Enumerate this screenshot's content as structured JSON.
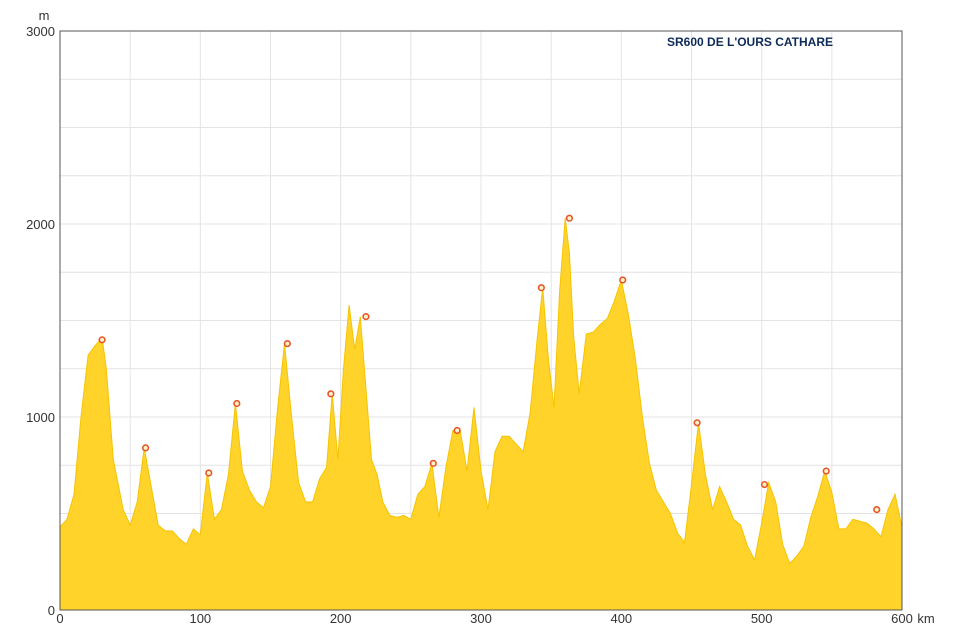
{
  "chart_data": {
    "type": "area",
    "title": "SR600 DE L'OURS CATHARE",
    "xlabel": "",
    "ylabel": "",
    "x_unit": "km",
    "y_unit": "m",
    "xlim": [
      0,
      600
    ],
    "ylim": [
      0,
      3000
    ],
    "x_ticks": [
      "0",
      "100",
      "200",
      "300",
      "400",
      "500",
      "600"
    ],
    "y_ticks": [
      "0",
      "1000",
      "2000",
      "3000"
    ],
    "grid": true,
    "colors": {
      "fill": "#ffd32a",
      "marker_stroke": "#e8542a",
      "grid": "#e4e4e4"
    },
    "series": [
      {
        "x": [
          0,
          5,
          10,
          15,
          20,
          25,
          30,
          33,
          38,
          45,
          50,
          55,
          60,
          65,
          70,
          75,
          80,
          85,
          90,
          95,
          100,
          105,
          110,
          115,
          120,
          125,
          130,
          135,
          140,
          145,
          150,
          155,
          160,
          165,
          170,
          175,
          180,
          185,
          190,
          194,
          198,
          202,
          206,
          210,
          214,
          218,
          222,
          226,
          230,
          235,
          240,
          245,
          250,
          255,
          260,
          265,
          270,
          275,
          280,
          285,
          290,
          295,
          300,
          305,
          310,
          315,
          320,
          325,
          330,
          335,
          340,
          344,
          348,
          352,
          356,
          360,
          363,
          366,
          370,
          375,
          380,
          385,
          390,
          395,
          400,
          405,
          410,
          415,
          420,
          425,
          430,
          435,
          440,
          445,
          450,
          455,
          460,
          465,
          470,
          475,
          480,
          485,
          490,
          495,
          500,
          505,
          510,
          515,
          520,
          525,
          530,
          535,
          540,
          545,
          550,
          555,
          560,
          565,
          570,
          575,
          580,
          585,
          590,
          595,
          600
        ],
        "y": [
          430,
          470,
          600,
          1000,
          1320,
          1370,
          1410,
          1250,
          780,
          520,
          440,
          560,
          840,
          640,
          440,
          410,
          410,
          370,
          340,
          420,
          390,
          710,
          470,
          520,
          700,
          1070,
          720,
          620,
          560,
          530,
          640,
          1040,
          1380,
          1000,
          660,
          560,
          560,
          680,
          740,
          1120,
          780,
          1250,
          1580,
          1350,
          1520,
          1150,
          780,
          700,
          560,
          490,
          480,
          490,
          470,
          600,
          640,
          760,
          480,
          740,
          930,
          940,
          720,
          1050,
          720,
          520,
          820,
          900,
          900,
          860,
          820,
          1020,
          1400,
          1670,
          1300,
          1050,
          1650,
          2030,
          1850,
          1420,
          1120,
          1430,
          1440,
          1480,
          1510,
          1600,
          1710,
          1530,
          1300,
          1000,
          760,
          620,
          560,
          500,
          400,
          350,
          650,
          970,
          700,
          520,
          640,
          560,
          470,
          440,
          330,
          260,
          450,
          660,
          560,
          340,
          240,
          280,
          330,
          480,
          590,
          720,
          610,
          420,
          420,
          470,
          460,
          450,
          420,
          380,
          520,
          600,
          430
        ],
        "markers": [
          {
            "x": 30,
            "y": 1400
          },
          {
            "x": 61,
            "y": 840
          },
          {
            "x": 106,
            "y": 710
          },
          {
            "x": 126,
            "y": 1070
          },
          {
            "x": 162,
            "y": 1380
          },
          {
            "x": 193,
            "y": 1120
          },
          {
            "x": 218,
            "y": 1520
          },
          {
            "x": 266,
            "y": 760
          },
          {
            "x": 283,
            "y": 930
          },
          {
            "x": 343,
            "y": 1670
          },
          {
            "x": 363,
            "y": 2030
          },
          {
            "x": 401,
            "y": 1710
          },
          {
            "x": 454,
            "y": 970
          },
          {
            "x": 502,
            "y": 650
          },
          {
            "x": 546,
            "y": 720
          },
          {
            "x": 582,
            "y": 520
          }
        ]
      }
    ]
  }
}
